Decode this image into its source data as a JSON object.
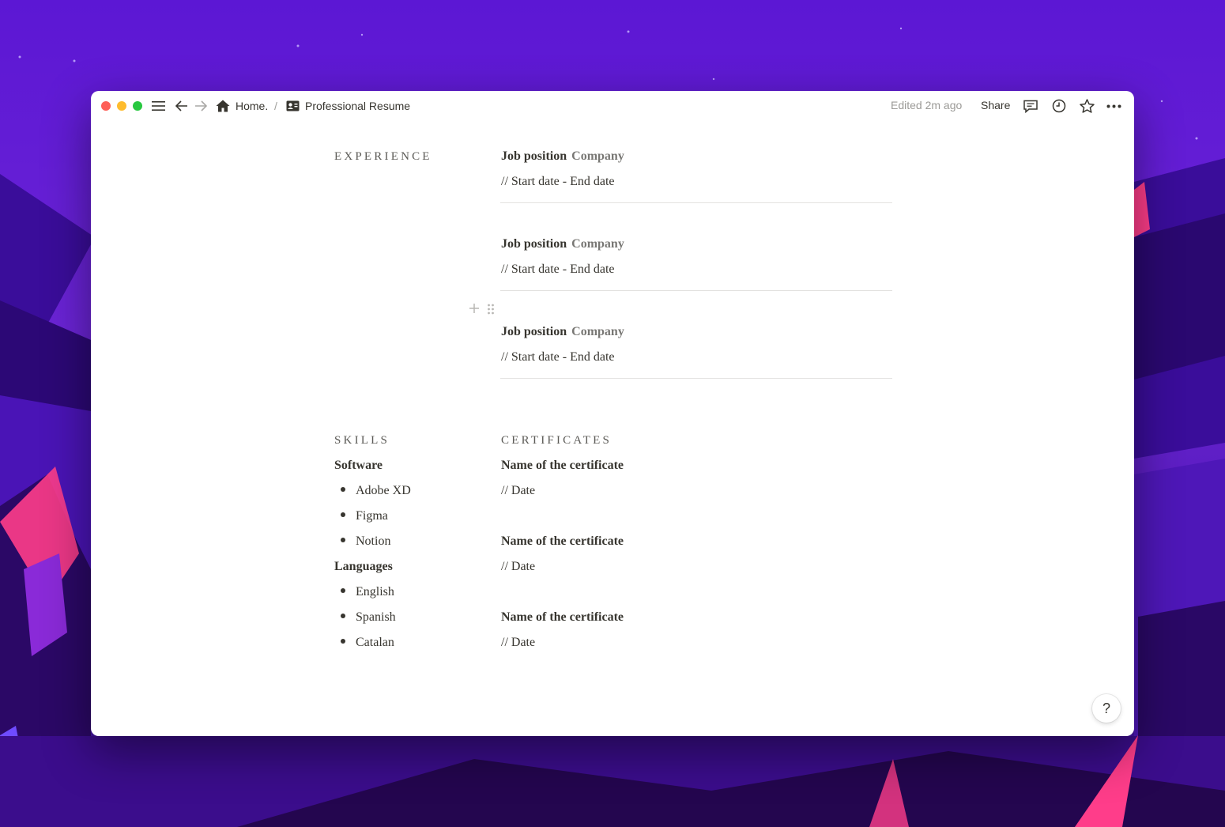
{
  "breadcrumb": {
    "home_label": "Home.",
    "separator": "/",
    "page_label": "Professional Resume"
  },
  "topbar": {
    "edited": "Edited 2m ago",
    "share_label": "Share"
  },
  "experience": {
    "title": "EXPERIENCE",
    "entries": [
      {
        "position": "Job position",
        "company": "Company",
        "dates": "// Start date - End date"
      },
      {
        "position": "Job position",
        "company": "Company",
        "dates": "// Start date - End date"
      },
      {
        "position": "Job position",
        "company": "Company",
        "dates": "// Start date - End date"
      }
    ]
  },
  "skills": {
    "title": "SKILLS",
    "software_label": "Software",
    "software": [
      "Adobe XD",
      "Figma",
      "Notion"
    ],
    "languages_label": "Languages",
    "languages": [
      "English",
      "Spanish",
      "Catalan"
    ]
  },
  "certificates": {
    "title": "CERTIFICATES",
    "items": [
      {
        "name": "Name of the certificate",
        "date": "// Date"
      },
      {
        "name": "Name of the certificate",
        "date": "// Date"
      },
      {
        "name": "Name of the certificate",
        "date": "// Date"
      }
    ]
  },
  "help_label": "?",
  "colors": {
    "background": "#5a18d6",
    "accent_pink": "#ff3d7f",
    "text": "#37352f",
    "muted": "#787774"
  }
}
